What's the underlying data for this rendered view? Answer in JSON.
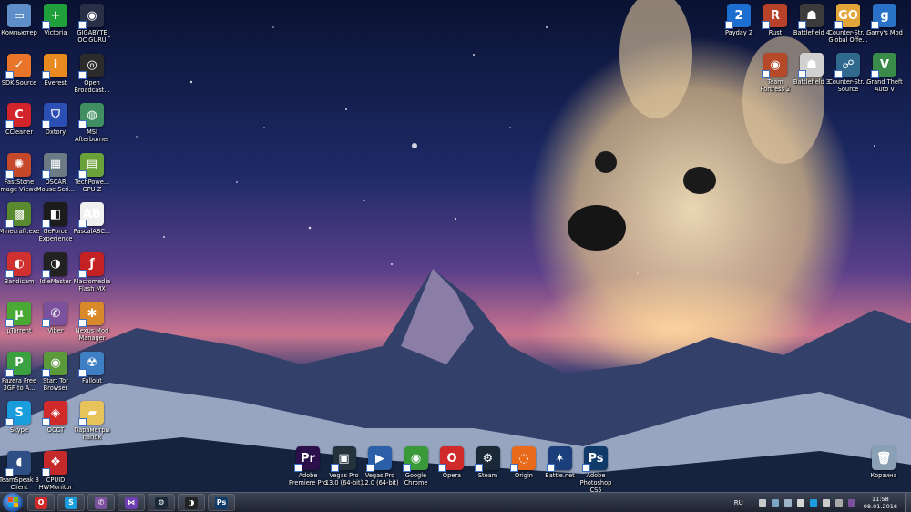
{
  "desktop": {
    "left_icons": [
      {
        "label": "Компьютер",
        "icon": "computer-icon",
        "color": "#5f8fc8",
        "glyph": "▭"
      },
      {
        "label": "Victoria",
        "icon": "victoria-cross-icon",
        "color": "#1fa03a",
        "glyph": "+"
      },
      {
        "label": "GIGABYTE\nOC GURU",
        "icon": "gigabyte-icon",
        "color": "#2a2f48",
        "glyph": "◉"
      },
      {
        "label": "SDK Source",
        "icon": "check-icon",
        "color": "#e8752a",
        "glyph": "✓"
      },
      {
        "label": "Everest",
        "icon": "info-icon",
        "color": "#e88a1f",
        "glyph": "i"
      },
      {
        "label": "Open\nBroadcast...",
        "icon": "obs-icon",
        "color": "#2b2b2b",
        "glyph": "◎"
      },
      {
        "label": "CCleaner",
        "icon": "ccleaner-icon",
        "color": "#d4242b",
        "glyph": "C"
      },
      {
        "label": "Dxtory",
        "icon": "shield-icon",
        "color": "#2c4fb5",
        "glyph": "⛉"
      },
      {
        "label": "MSI\nAfterburner",
        "icon": "msi-globe-icon",
        "color": "#3f8f62",
        "glyph": "◍"
      },
      {
        "label": "FastStone\nImage Viewer",
        "icon": "faststone-icon",
        "color": "#c6482b",
        "glyph": "✺"
      },
      {
        "label": "OSCAR\nMouse Scri...",
        "icon": "oscar-icon",
        "color": "#6c7a86",
        "glyph": "▦"
      },
      {
        "label": "TechPowe...\nGPU-Z",
        "icon": "gpuz-icon",
        "color": "#6aa23a",
        "glyph": "▤"
      },
      {
        "label": "Minecraft.exe",
        "icon": "minecraft-icon",
        "color": "#5a8a2f",
        "glyph": "▩"
      },
      {
        "label": "GeForce\nExperience",
        "icon": "geforce-icon",
        "color": "#1c1c1c",
        "glyph": "◧"
      },
      {
        "label": "PascalABC...",
        "icon": "pascalabc-icon",
        "color": "#f0f0f0",
        "glyph": "AB"
      },
      {
        "label": "Bandicam",
        "icon": "bandicam-icon",
        "color": "#d03030",
        "glyph": "◐"
      },
      {
        "label": "IdleMaster",
        "icon": "idlemaster-icon",
        "color": "#222222",
        "glyph": "◑"
      },
      {
        "label": "Macromedia\nFlash MX",
        "icon": "flash-icon",
        "color": "#c42222",
        "glyph": "ƒ"
      },
      {
        "label": "µTorrent",
        "icon": "utorrent-icon",
        "color": "#4aa834",
        "glyph": "µ"
      },
      {
        "label": "Viber",
        "icon": "viber-icon",
        "color": "#7b519d",
        "glyph": "✆"
      },
      {
        "label": "Nexus Mod\nManager",
        "icon": "nexus-icon",
        "color": "#d88a2a",
        "glyph": "✱"
      },
      {
        "label": "Pazera Free\n3GP to A...",
        "icon": "pazera-icon",
        "color": "#3aa040",
        "glyph": "P"
      },
      {
        "label": "Start Tor\nBrowser",
        "icon": "tor-icon",
        "color": "#5a9a3a",
        "glyph": "◉"
      },
      {
        "label": "Fallout",
        "icon": "fallout-icon",
        "color": "#3d7fc2",
        "glyph": "☢"
      },
      {
        "label": "Skype",
        "icon": "skype-icon",
        "color": "#1a9ddc",
        "glyph": "S"
      },
      {
        "label": "OCCT",
        "icon": "occt-icon",
        "color": "#d12a2a",
        "glyph": "◈"
      },
      {
        "label": "Параметры\nпапок",
        "icon": "folder-icon",
        "color": "#e8c35a",
        "glyph": "▰"
      },
      {
        "label": "TeamSpeak 3\nClient",
        "icon": "teamspeak-icon",
        "color": "#2e4e86",
        "glyph": "◖"
      },
      {
        "label": "CPUID\nHWMonitor",
        "icon": "hwmonitor-icon",
        "color": "#c42a2a",
        "glyph": "❖"
      }
    ],
    "right_icons": [
      {
        "label": "Payday 2",
        "icon": "payday-icon",
        "color": "#1c6fd0",
        "glyph": "2"
      },
      {
        "label": "Rust",
        "icon": "rust-icon",
        "color": "#b8412a",
        "glyph": "R"
      },
      {
        "label": "Battlefield 4",
        "icon": "battlefield4-icon",
        "color": "#3b3b3b",
        "glyph": "☗"
      },
      {
        "label": "Counter-Str...\nGlobal Offe...",
        "icon": "csgo-icon",
        "color": "#e3a43a",
        "glyph": "GO"
      },
      {
        "label": "Garry's Mod",
        "icon": "garrysmod-icon",
        "color": "#2a72c7",
        "glyph": "g"
      },
      {
        "label": "Team\nFortress 2",
        "icon": "tf2-icon",
        "color": "#b5492a",
        "glyph": "◉"
      },
      {
        "label": "Battlefield 3",
        "icon": "battlefield3-icon",
        "color": "#d0d0d0",
        "glyph": "☗"
      },
      {
        "label": "Counter-Str...\nSource",
        "icon": "css-icon",
        "color": "#2f6a8e",
        "glyph": "☍"
      },
      {
        "label": "Grand Theft\nAuto V",
        "icon": "gta-icon",
        "color": "#3a8a4a",
        "glyph": "V"
      }
    ],
    "bottom_icons": [
      {
        "label": "Adobe\nPremiere Pro",
        "icon": "premiere-icon",
        "color": "#2a0f4a",
        "glyph": "Pr"
      },
      {
        "label": "Vegas Pro\n13.0 (64-bit)",
        "icon": "vegas13-icon",
        "color": "#24323e",
        "glyph": "▣"
      },
      {
        "label": "Vegas Pro\n12.0 (64-bit)",
        "icon": "vegas12-icon",
        "color": "#2b5fa8",
        "glyph": "▶"
      },
      {
        "label": "Google\nChrome",
        "icon": "chrome-icon",
        "color": "#3a9a3a",
        "glyph": "◉"
      },
      {
        "label": "Opera",
        "icon": "opera-icon",
        "color": "#d12a2a",
        "glyph": "O"
      },
      {
        "label": "Steam",
        "icon": "steam-icon",
        "color": "#1b2838",
        "glyph": "⚙"
      },
      {
        "label": "Origin",
        "icon": "origin-icon",
        "color": "#e86a1a",
        "glyph": "◌"
      },
      {
        "label": "Battle.net",
        "icon": "battlenet-icon",
        "color": "#1b3f7a",
        "glyph": "✶"
      },
      {
        "label": "Adobe\nPhotoshop\nCS5",
        "icon": "photoshop-icon",
        "color": "#0f3a6a",
        "glyph": "Ps"
      }
    ],
    "recycle_bin": {
      "label": "Корзина",
      "icon": "recycle-bin-icon",
      "color": "#8aa0b5",
      "glyph": "🗑"
    }
  },
  "taskbar": {
    "pinned": [
      {
        "icon": "opera-icon",
        "color": "#d12a2a",
        "glyph": "O"
      },
      {
        "icon": "skype-icon",
        "color": "#1a9ddc",
        "glyph": "S"
      },
      {
        "icon": "viber-icon",
        "color": "#7b519d",
        "glyph": "✆"
      },
      {
        "icon": "visual-studio-icon",
        "color": "#6d3fb2",
        "glyph": "⋈"
      },
      {
        "icon": "steam-icon",
        "color": "#1b2838",
        "glyph": "⚙"
      },
      {
        "icon": "idlemaster-icon",
        "color": "#222222",
        "glyph": "◑"
      },
      {
        "icon": "photoshop-icon",
        "color": "#0f3a6a",
        "glyph": "Ps"
      }
    ],
    "language": "RU",
    "clock_time": "11:58",
    "clock_date": "08.01.2016"
  }
}
